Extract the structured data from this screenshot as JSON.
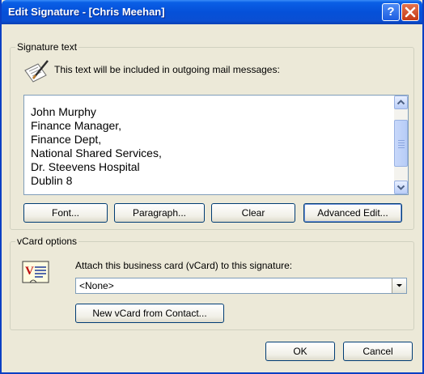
{
  "window": {
    "title": "Edit Signature - [Chris Meehan]",
    "help_glyph": "?",
    "accent": "#0a4fd3"
  },
  "signature": {
    "group_label": "Signature text",
    "hint": "This text will be included in outgoing mail messages:",
    "lines": [
      "John Murphy",
      "Finance Manager,",
      "Finance Dept,",
      "National Shared Services,",
      "Dr. Steevens Hospital",
      "Dublin 8"
    ],
    "buttons": {
      "font": "Font...",
      "paragraph": "Paragraph...",
      "clear": "Clear",
      "advanced": "Advanced Edit..."
    }
  },
  "vcard": {
    "group_label": "vCard options",
    "attach_label": "Attach this business card (vCard) to this signature:",
    "selected": "<None>",
    "new_button": "New vCard from Contact..."
  },
  "footer": {
    "ok": "OK",
    "cancel": "Cancel"
  }
}
